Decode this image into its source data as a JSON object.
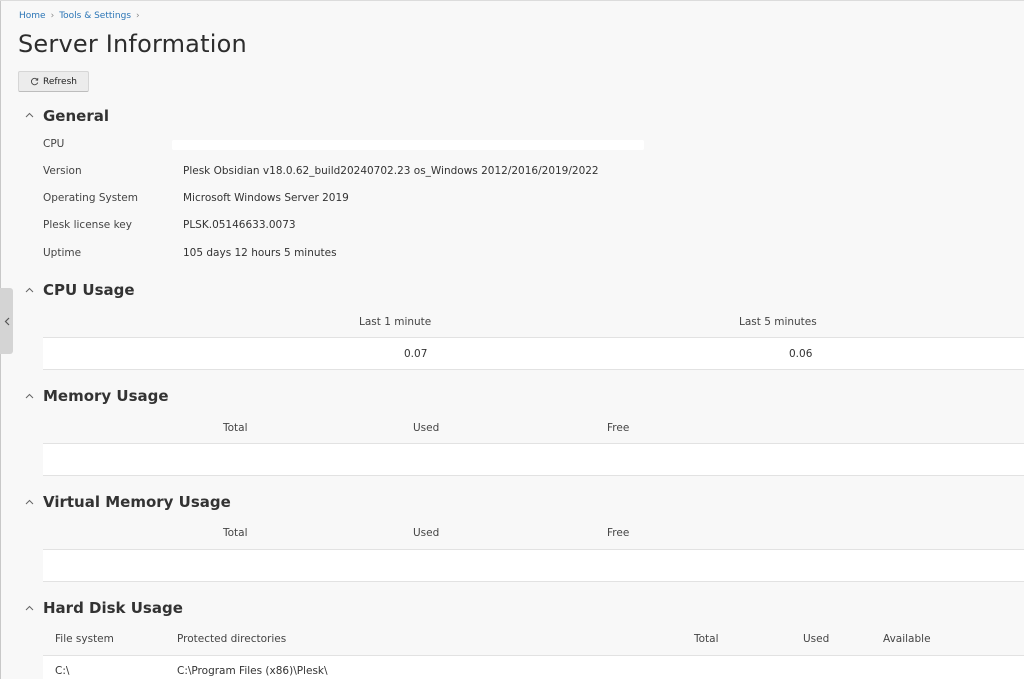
{
  "breadcrumb": {
    "home": "Home",
    "tools": "Tools & Settings"
  },
  "page_title": "Server Information",
  "toolbar": {
    "refresh_label": "Refresh"
  },
  "general": {
    "title": "General",
    "rows": [
      {
        "label": "CPU",
        "value": ""
      },
      {
        "label": "Version",
        "value": "Plesk Obsidian v18.0.62_build20240702.23 os_Windows 2012/2016/2019/2022"
      },
      {
        "label": "Operating System",
        "value": "Microsoft Windows Server 2019"
      },
      {
        "label": "Plesk license key",
        "value": "PLSK.05146633.0073"
      },
      {
        "label": "Uptime",
        "value": "105 days 12 hours 5 minutes"
      }
    ]
  },
  "cpu_usage": {
    "title": "CPU Usage",
    "headers": [
      "Last 1 minute",
      "Last 5 minutes"
    ],
    "values": [
      "0.07",
      "0.06"
    ]
  },
  "memory_usage": {
    "title": "Memory Usage",
    "headers": [
      "Total",
      "Used",
      "Free"
    ]
  },
  "virtual_memory_usage": {
    "title": "Virtual Memory Usage",
    "headers": [
      "Total",
      "Used",
      "Free"
    ]
  },
  "hard_disk_usage": {
    "title": "Hard Disk Usage",
    "headers": [
      "File system",
      "Protected directories",
      "Total",
      "Used",
      "Available"
    ],
    "rows": [
      {
        "fs": "C:\\",
        "protected": "C:\\Program Files (x86)\\Plesk\\"
      }
    ]
  },
  "icons": {
    "refresh": "refresh-icon",
    "collapse": "chevron-up-icon",
    "sidebar": "chevron-left-icon"
  },
  "colors": {
    "link": "#2b75b6",
    "background": "#f8f8f8",
    "table_row": "#ffffff"
  }
}
